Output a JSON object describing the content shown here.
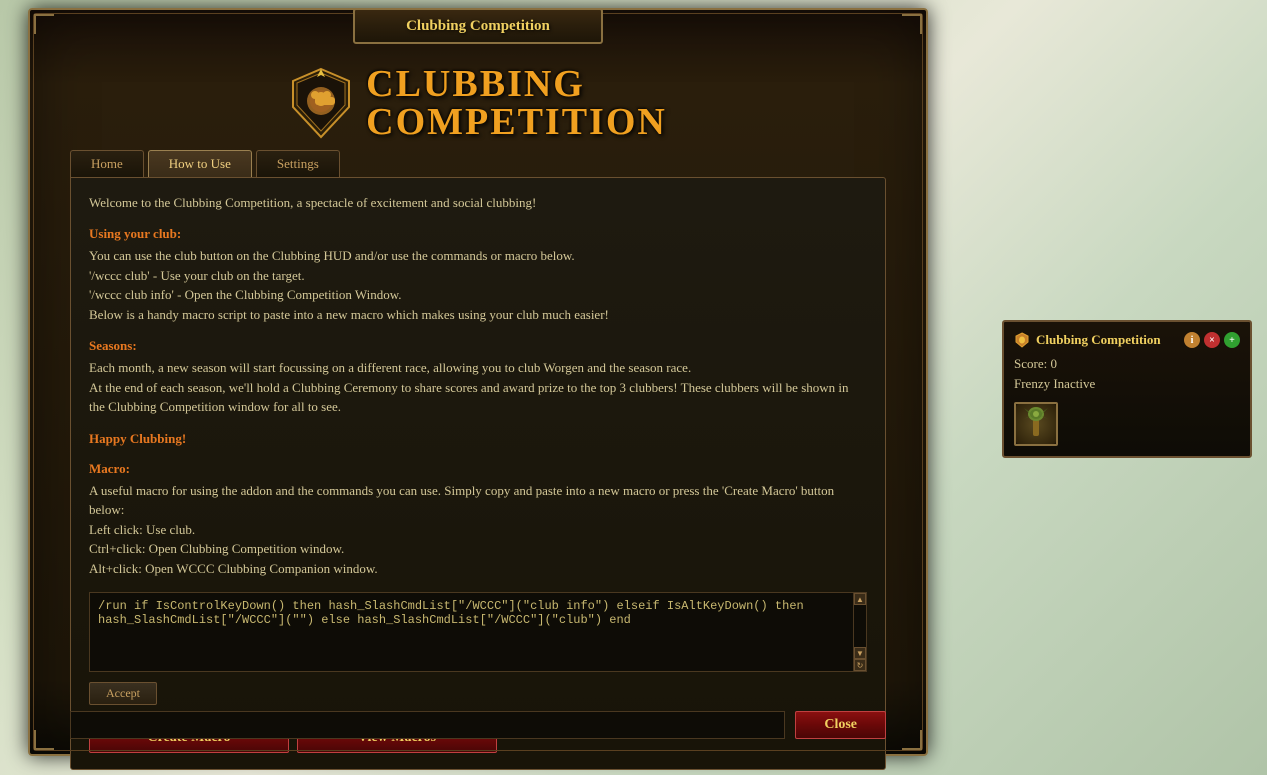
{
  "window": {
    "title": "Clubbing Competition",
    "logo_line1": "CLUBBING",
    "logo_line2": "COMPETITION"
  },
  "tabs": [
    {
      "label": "Home",
      "active": false
    },
    {
      "label": "How to Use",
      "active": true
    },
    {
      "label": "Settings",
      "active": false
    }
  ],
  "content": {
    "welcome": "Welcome to the Clubbing Competition, a spectacle of excitement and social clubbing!",
    "section_using_title": "Using your club:",
    "section_using_body": "You can use the club button on the Clubbing HUD and/or use the commands or macro below.\n'/wccc club' - Use your club on the target.\n'/wccc club info' - Open the Clubbing Competition Window.\nBelow is a handy macro script to paste into a new macro which makes using your club much easier!",
    "section_seasons_title": "Seasons:",
    "section_seasons_body": "Each month, a new season will start focussing on a different race, allowing you to club Worgen and the season race.\nAt the end of each season, we'll hold a Clubbing Ceremony to share scores and award prize to the top 3 clubbers! These clubbers will be shown in the Clubbing Competition window for all to see.",
    "happy_text": "Happy Clubbing!",
    "section_macro_title": "Macro:",
    "section_macro_body": "A useful macro for using the addon and the commands you can use. Simply copy and paste into a new macro or press the 'Create Macro' button below:\n Left click: Use club.\n Ctrl+click: Open Clubbing Competition window.\n Alt+click: Open WCCC Clubbing Companion window.",
    "macro_code": "/run if IsControlKeyDown() then hash_SlashCmdList[\"/WCCC\"](\"club info\") elseif IsAltKeyDown() then hash_SlashCmdList[\"/WCCC\"](\"\") else hash_SlashCmdList[\"/WCCC\"](\"club\") end",
    "accept_label": "Accept",
    "create_macro_label": "Create Macro",
    "view_macros_label": "View Macros"
  },
  "side_panel": {
    "title": "Clubbing Competition",
    "score_label": "Score: 0",
    "frenzy_label": "Frenzy Inactive",
    "icons": {
      "info": "i",
      "stop": "●",
      "plus": "+"
    }
  },
  "bottom": {
    "close_label": "Close"
  }
}
